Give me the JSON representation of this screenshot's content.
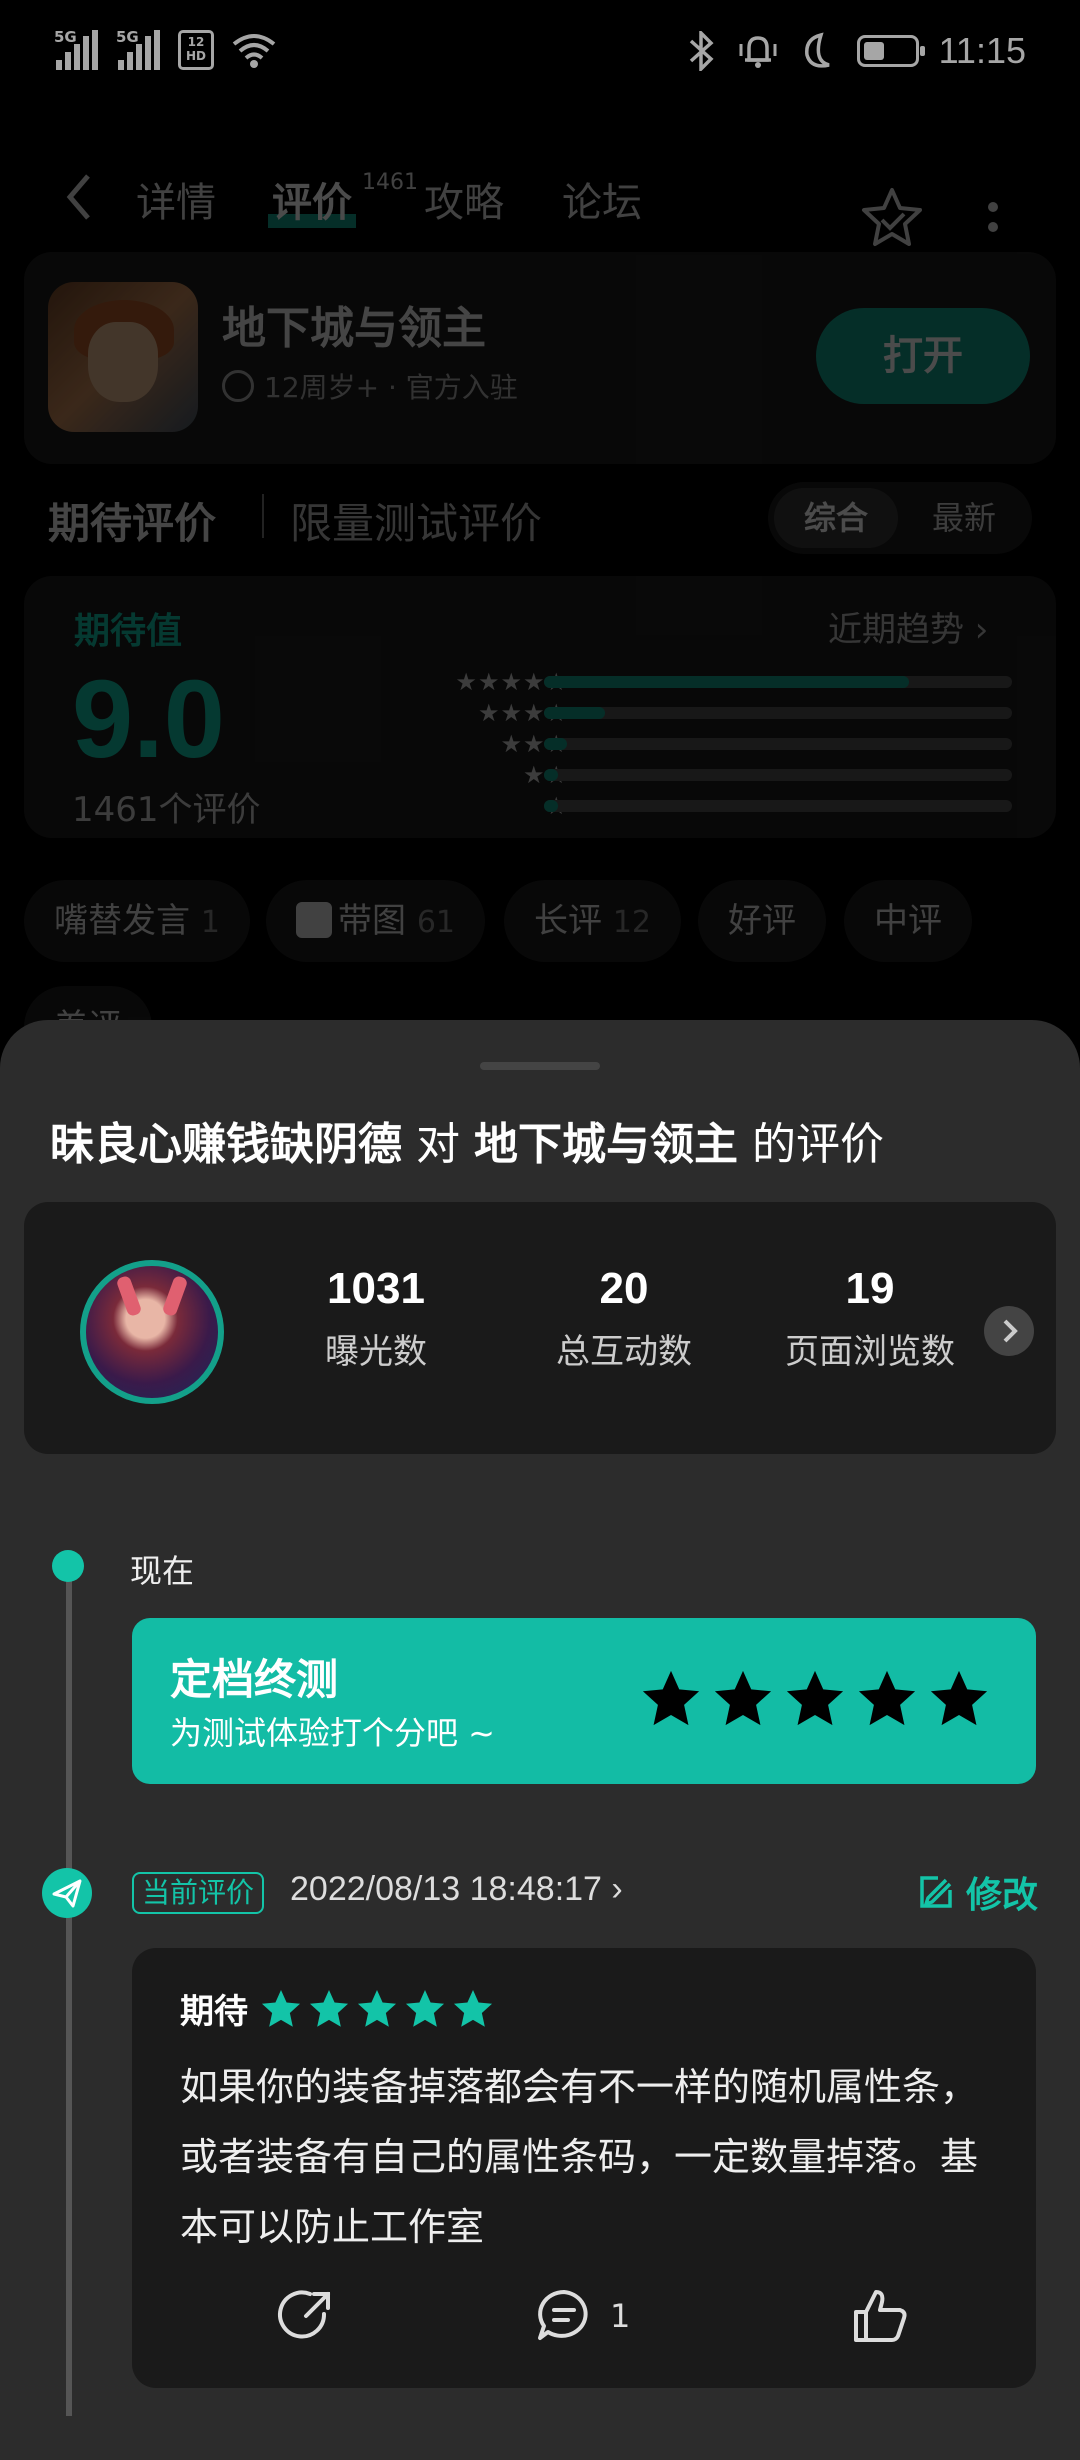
{
  "status_bar": {
    "signal1_label": "5G",
    "signal2_label": "5G",
    "hd_label": "HD",
    "time": "11:15"
  },
  "nav": {
    "tabs": [
      {
        "label": "详情"
      },
      {
        "label": "评价"
      },
      {
        "label": "攻略"
      },
      {
        "label": "论坛"
      }
    ],
    "review_count_badge": "1461",
    "icons": [
      "back-icon",
      "star-outline-icon",
      "more-vert-icon"
    ]
  },
  "game": {
    "name": "地下城与领主",
    "meta": "12周岁+ · 官方入驻",
    "open_label": "打开"
  },
  "ratings": {
    "tab_expect": "期待评价",
    "tab_limited": "限量测试评价",
    "sort_options": [
      "综合",
      "最新"
    ],
    "expect_label": "期待值",
    "trend_label": "近期趋势",
    "score": "9.0",
    "count_label": "1461个评价",
    "distribution": [
      {
        "stars": "★★★★★",
        "fraction": 0.78
      },
      {
        "stars": "★★★★",
        "fraction": 0.13
      },
      {
        "stars": "★★★",
        "fraction": 0.05
      },
      {
        "stars": "★★",
        "fraction": 0.03
      },
      {
        "stars": "★",
        "fraction": 0.03
      }
    ]
  },
  "chips": [
    {
      "label": "嘴替发言",
      "count": "1"
    },
    {
      "label": "带图",
      "count": "61"
    },
    {
      "label": "长评",
      "count": "12"
    },
    {
      "label": "好评",
      "count": ""
    },
    {
      "label": "中评",
      "count": ""
    },
    {
      "label": "差评",
      "count": ""
    }
  ],
  "sheet": {
    "title_user": "昧良心赚钱缺阴德",
    "title_mid": "对",
    "title_game": "地下城与领主",
    "title_end": "的评价",
    "stats": [
      {
        "value": "1031",
        "label": "曝光数"
      },
      {
        "value": "20",
        "label": "总互动数"
      },
      {
        "value": "19",
        "label": "页面浏览数"
      }
    ],
    "now_label": "现在",
    "banner_title": "定档终测",
    "banner_sub": "为测试体验打个分吧 ~",
    "current_badge": "当前评价",
    "current_date": "2022/08/13 18:48:17",
    "edit_label": "修改",
    "review_kind": "期待",
    "review_rating": 5,
    "review_text": "如果你的装备掉落都会有不一样的随机属性条，或者装备有自己的属性条码，一定数量掉落。基本可以防止工作室",
    "comment_count": "1"
  },
  "colors": {
    "accent": "#13c4a8",
    "accent_dark": "#13a08a",
    "sheet_bg": "#2c2c2c",
    "card_bg": "#1a1a1a"
  }
}
